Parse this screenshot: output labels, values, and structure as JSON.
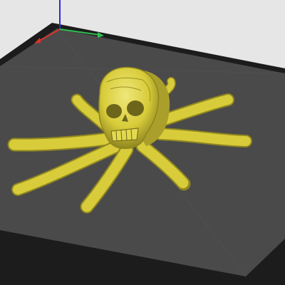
{
  "viewport": {
    "background_color": "#e6e6e6",
    "bed": {
      "surface_color": "#4a4a4a",
      "edge_color": "#1c1c1c",
      "grid_color": "#5a5a5a"
    },
    "axes": {
      "x_color": "#d9342b",
      "y_color": "#2fbf4f",
      "z_color": "#2a2ad6"
    },
    "model": {
      "name": "skull octopus",
      "color": "#d8cc3a",
      "shade_color": "#8f8620",
      "highlight_color": "#efe77a"
    }
  }
}
